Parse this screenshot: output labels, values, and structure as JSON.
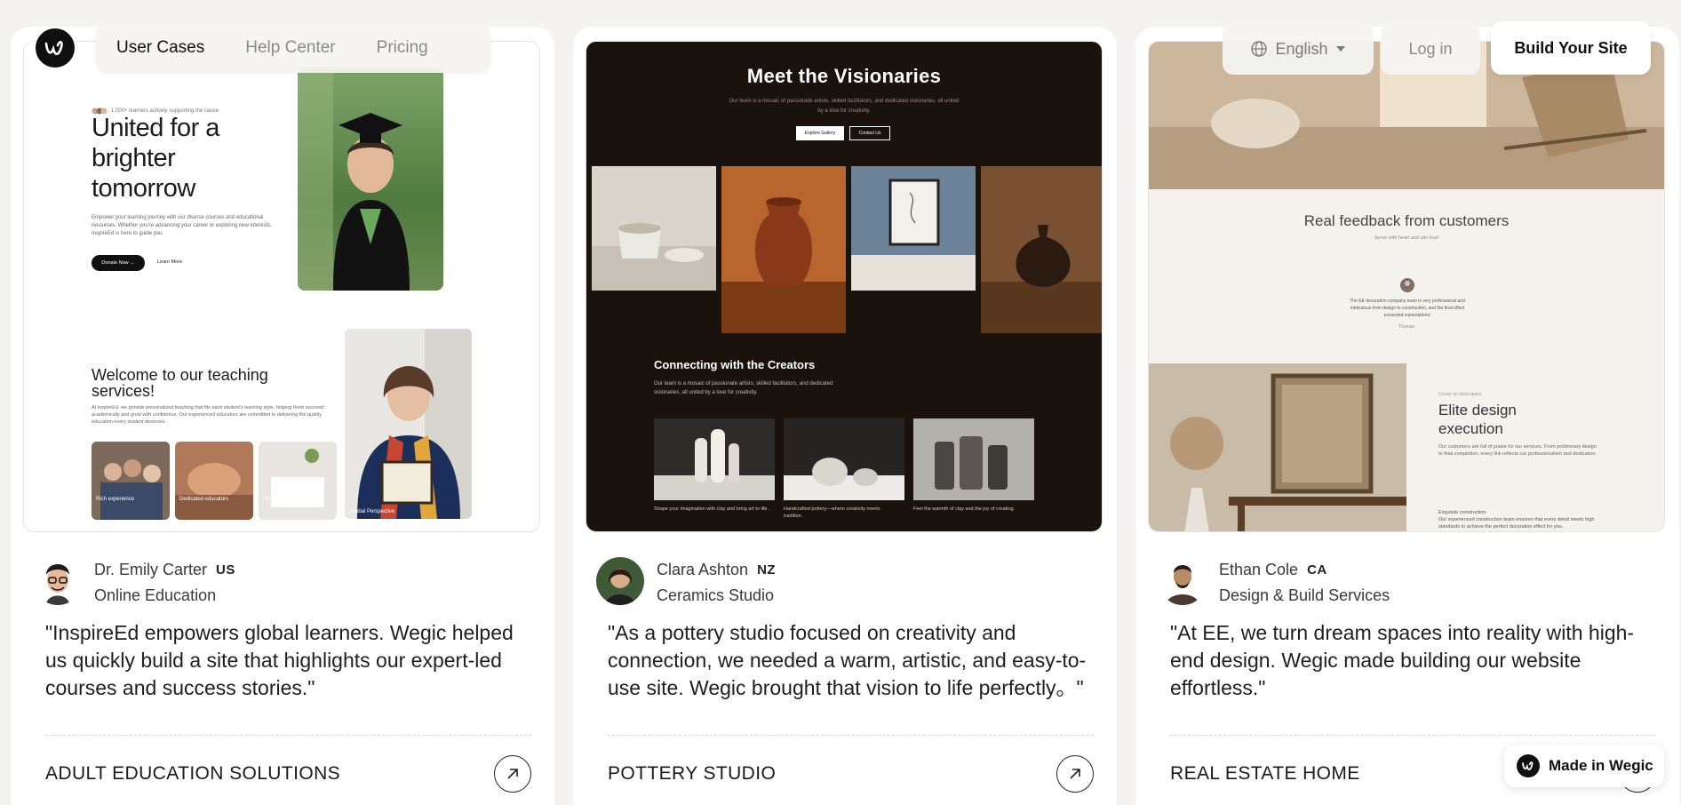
{
  "nav": {
    "links": [
      "User Cases",
      "Help Center",
      "Pricing"
    ],
    "language": "English",
    "login": "Log in",
    "build": "Build Your Site"
  },
  "badge": {
    "label": "Made in Wegic"
  },
  "cards": [
    {
      "author": "Dr. Emily Carter",
      "country": "US",
      "role": "Online Education",
      "quote": "\"InspireEd empowers global learners. Wegic helped us quickly build a site that highlights our expert-led courses and success stories.\"",
      "category": "ADULT EDUCATION SOLUTIONS",
      "preview": {
        "topline": "1,000+ learners actively supporting the cause",
        "hero_title": "United for a brighter tomorrow",
        "hero_desc": "Empower your learning journey with our diverse courses and educational resources. Whether you're advancing your career or exploring new interests, InspireEd is here to guide you.",
        "donate": "Donate Now →",
        "learn": "Learn More",
        "welcome_title": "Welcome to our teaching services!",
        "welcome_desc": "At InspireEd, we provide personalized teaching that fits each student's learning style, helping them succeed academically and grow with confidence. Our experienced educators are committed to delivering the quality education every student deserves.",
        "thumbs": [
          "Rich experience",
          "Dedicated educators",
          "Diligent work"
        ],
        "global": "Global Perspective"
      }
    },
    {
      "author": "Clara Ashton",
      "country": "NZ",
      "role": "Ceramics Studio",
      "quote": "\"As a pottery studio focused on creativity and connection, we needed a warm, artistic, and easy-to-use site. Wegic brought that vision to life perfectly。\"",
      "category": "POTTERY STUDIO",
      "preview": {
        "title": "Meet the Visionaries",
        "sub": "Our team is a mosaic of passionate artists, skilled facilitators, and dedicated visionaries, all united by a love for creativity.",
        "btn1": "Explore Gallery",
        "btn2": "Contact Us",
        "sec_title": "Connecting with the Creators",
        "sec_desc": "Our team is a mosaic of passionate artists, skilled facilitators, and dedicated visionaries, all united by a love for creativity.",
        "captions": [
          "Shape your imagination with clay and bring art to life.",
          "Handcrafted pottery—where creativity meets tradition.",
          "Feel the warmth of clay and the joy of creating."
        ]
      }
    },
    {
      "author": "Ethan Cole",
      "country": "CA",
      "role": "Design & Build Services",
      "quote": "\"At EE, we turn dream spaces into reality with high-end design. Wegic made building our website effortless.\"",
      "category": "REAL ESTATE HOME",
      "preview": {
        "fb_title": "Real feedback from customers",
        "fb_sub": "Serve with heart and win trust",
        "fb_text": "The EE decoration company team is very professional and meticulous from design to construction, and the final effect exceeded expectations!",
        "fb_name": "Thomas",
        "elite_tag": "Create an ideal space",
        "elite_title": "Elite design execution",
        "elite_desc": "Our customers are full of praise for our services. From preliminary design to final completion, every link reflects our professionalism and dedication.",
        "exq_title": "Exquisite construction",
        "exq_desc": "Our experienced construction team ensures that every detail meets high standards to achieve the perfect decoration effect for you."
      }
    }
  ],
  "colors": {
    "page_bg": "#f4f3f1",
    "pottery_bg": "#1a120c",
    "dark": "#111111"
  },
  "icons": [
    "wegic-logo-icon",
    "globe-icon",
    "caret-down-icon",
    "arrow-up-right-icon"
  ]
}
